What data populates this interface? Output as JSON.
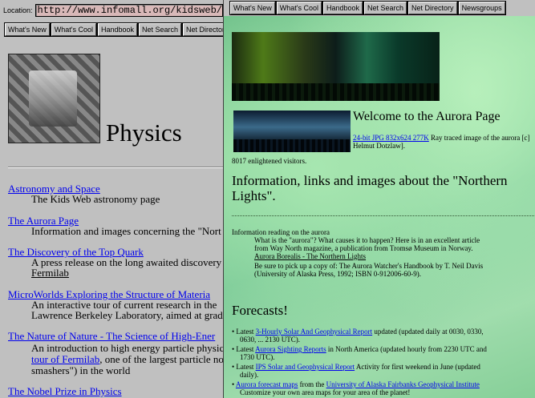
{
  "left_window": {
    "location_label": "Location:",
    "location_value": "http://www.infomall.org/kidsweb/",
    "buttons": [
      "What's New",
      "What's Cool",
      "Handbook",
      "Net Search",
      "Net Director"
    ],
    "page_title": "Physics",
    "entries": [
      {
        "link": "Astronomy and Space",
        "desc": [
          "The Kids Web astronomy page"
        ]
      },
      {
        "link": "The Aurora Page",
        "desc": [
          "Information and images concerning the \"Nort"
        ]
      },
      {
        "link": "The Discovery of the Top Quark",
        "desc": [
          "A press release on the long   awaited discovery"
        ],
        "desc_link": "Fermilab"
      },
      {
        "link": "MicroWorlds   Exploring the Structure of Materia",
        "desc": [
          "An interactive tour of current research in the",
          "Lawrence Berkeley Laboratory, aimed at grad"
        ]
      },
      {
        "link": "The Nature of Nature - The Science of High-Ener",
        "desc": [
          "An introduction to high energy particle physic"
        ],
        "desc_link_line": {
          "link": "tour of Fermilab",
          "after": ", one of the largest particle no"
        },
        "desc_extra": [
          "smashers\") in the world"
        ]
      },
      {
        "link": "The Nobel Prize in Physics",
        "desc": []
      }
    ]
  },
  "right_window": {
    "buttons": [
      "What's New",
      "What's Cool",
      "Handbook",
      "Net Search",
      "Net Directory",
      "Newsgroups"
    ],
    "title": "Welcome to the Aurora Page",
    "caption_link": "24-bit JPG 832x624 277K",
    "caption_text": " Ray traced image of the aurora [c] Helmut Dotzlaw].",
    "visitors": "8017 enlightened visitors.",
    "heading": "Information, links and images about the \"Northern Lights\".",
    "info_label": "Information reading on the aurora",
    "info_lines": [
      "What is the \"aurora\"? What causes it to happen? Here is in an excellent article",
      "from Way North magazine, a publication from Tromsø Museum in Norway."
    ],
    "info_link_prefix": "Aurora",
    "info_link": "Borealis - The Northern Lights",
    "info_more": [
      "Be sure to pick up a copy of: The Aurora Watcher's Handbook by T. Neil Davis",
      "(University of Alaska Press, 1992; ISBN 0-912006-60-9)."
    ],
    "forecasts_title": "Forecasts!",
    "bullets": [
      {
        "pre": "• Latest ",
        "link": "3-Hourly Solar And Geophysical Report",
        "post": " updated (updated daily at 0030, 0330,",
        "cont": "0630, ... 2130 UTC)."
      },
      {
        "pre": "• Latest ",
        "link": "Aurora Sighting Reports",
        "post": " in North America (updated hourly from 2230 UTC and",
        "cont": "1730 UTC)."
      },
      {
        "pre": "• Latest ",
        "link": "IPS Solar and Geophysical Report",
        "post": " Activity for first weekend in June (updated",
        "cont": "daily)."
      },
      {
        "pre": "• ",
        "link": "Aurora forecast maps",
        "post": " from the ",
        "link2": "University of Alaska Fairbanks Geophysical Institute",
        "cont": "Customize your own area maps for your area of the planet!"
      }
    ]
  }
}
